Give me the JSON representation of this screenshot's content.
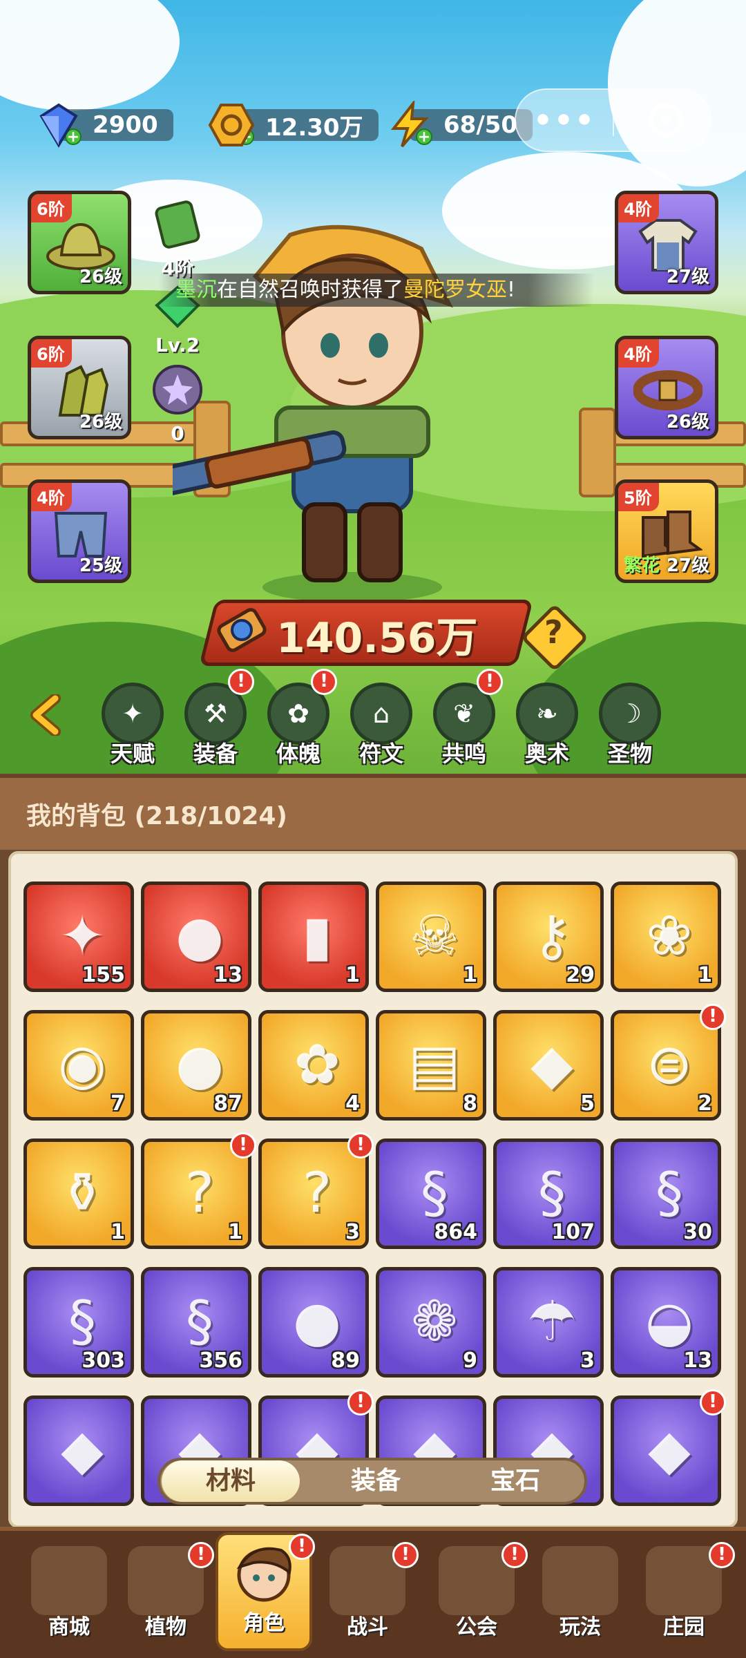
{
  "resources": {
    "gems": "2900",
    "gold": "12.30万",
    "energy": "68/50"
  },
  "equipment": {
    "left": [
      {
        "tier": "6阶",
        "level": "26级"
      },
      {
        "tier": "6阶",
        "level": "26级"
      },
      {
        "tier": "4阶",
        "level": "25级"
      }
    ],
    "right": [
      {
        "tier": "4阶",
        "level": "27级"
      },
      {
        "tier": "4阶",
        "level": "26级"
      },
      {
        "tier": "5阶",
        "level": "27级",
        "tag": "繁花"
      }
    ],
    "mini": [
      {
        "label": "4阶"
      },
      {
        "label": "Lv.2"
      },
      {
        "label": "0"
      }
    ]
  },
  "announcement": {
    "player": "墨沉",
    "middle": "在自然召唤时获得了",
    "reward": "曼陀罗女巫",
    "end": "!"
  },
  "power": "140.56万",
  "features": [
    {
      "label": "天赋",
      "badge": ""
    },
    {
      "label": "装备",
      "badge": "!"
    },
    {
      "label": "体魄",
      "badge": "!"
    },
    {
      "label": "符文",
      "badge": ""
    },
    {
      "label": "共鸣",
      "badge": "!"
    },
    {
      "label": "奥术",
      "badge": ""
    },
    {
      "label": "圣物",
      "badge": ""
    }
  ],
  "bag": {
    "title": "我的背包 (218/1024)",
    "items": [
      {
        "count": "155",
        "rarity": "red",
        "icon": "star-crystal-icon",
        "badge": ""
      },
      {
        "count": "13",
        "rarity": "red",
        "icon": "red-potion-icon",
        "badge": ""
      },
      {
        "count": "1",
        "rarity": "red",
        "icon": "green-vial-icon",
        "badge": ""
      },
      {
        "count": "1",
        "rarity": "gold",
        "icon": "skull-scroll-icon",
        "badge": ""
      },
      {
        "count": "29",
        "rarity": "gold",
        "icon": "golden-key-icon",
        "badge": ""
      },
      {
        "count": "1",
        "rarity": "gold",
        "icon": "golden-seed-icon",
        "badge": ""
      },
      {
        "count": "7",
        "rarity": "gold",
        "icon": "rune-stone-icon",
        "badge": ""
      },
      {
        "count": "87",
        "rarity": "gold",
        "icon": "orange-potion-icon",
        "badge": ""
      },
      {
        "count": "4",
        "rarity": "gold",
        "icon": "flower-pot-icon",
        "badge": ""
      },
      {
        "count": "8",
        "rarity": "gold",
        "icon": "spell-book-icon",
        "badge": ""
      },
      {
        "count": "5",
        "rarity": "gold",
        "icon": "amber-gem-icon",
        "badge": ""
      },
      {
        "count": "2",
        "rarity": "gold",
        "icon": "purple-scroll-icon",
        "badge": "!"
      },
      {
        "count": "1",
        "rarity": "gold",
        "icon": "red-flask-icon",
        "badge": ""
      },
      {
        "count": "1",
        "rarity": "gold",
        "icon": "mystery-armor-icon",
        "badge": "!"
      },
      {
        "count": "3",
        "rarity": "gold",
        "icon": "mystery-potion-icon",
        "badge": "!"
      },
      {
        "count": "864",
        "rarity": "purple",
        "icon": "green-scroll-icon",
        "badge": ""
      },
      {
        "count": "107",
        "rarity": "purple",
        "icon": "pink-scroll-icon",
        "badge": ""
      },
      {
        "count": "30",
        "rarity": "purple",
        "icon": "blue-scroll-icon",
        "badge": ""
      },
      {
        "count": "303",
        "rarity": "purple",
        "icon": "fire-scroll-icon",
        "badge": ""
      },
      {
        "count": "356",
        "rarity": "purple",
        "icon": "lightning-scroll-icon",
        "badge": ""
      },
      {
        "count": "89",
        "rarity": "purple",
        "icon": "purple-potion-icon",
        "badge": ""
      },
      {
        "count": "9",
        "rarity": "purple",
        "icon": "blue-flower-icon",
        "badge": ""
      },
      {
        "count": "3",
        "rarity": "purple",
        "icon": "watering-can-icon",
        "badge": ""
      },
      {
        "count": "13",
        "rarity": "purple",
        "icon": "fruit-bowl-icon",
        "badge": ""
      },
      {
        "count": "",
        "rarity": "purple",
        "icon": "item-icon",
        "badge": ""
      },
      {
        "count": "",
        "rarity": "purple",
        "icon": "item-icon",
        "badge": ""
      },
      {
        "count": "",
        "rarity": "purple",
        "icon": "item-icon",
        "badge": "!"
      },
      {
        "count": "",
        "rarity": "purple",
        "icon": "item-icon",
        "badge": ""
      },
      {
        "count": "",
        "rarity": "purple",
        "icon": "item-icon",
        "badge": ""
      },
      {
        "count": "",
        "rarity": "purple",
        "icon": "item-icon",
        "badge": "!"
      }
    ]
  },
  "tabs": [
    "材料",
    "装备",
    "宝石"
  ],
  "bottom_nav": [
    {
      "label": "商城",
      "badge": ""
    },
    {
      "label": "植物",
      "badge": "!"
    },
    {
      "label": "角色",
      "badge": "!"
    },
    {
      "label": "战斗",
      "badge": "!"
    },
    {
      "label": "公会",
      "badge": "!"
    },
    {
      "label": "玩法",
      "badge": ""
    },
    {
      "label": "庄园",
      "badge": "!"
    }
  ],
  "colors": {
    "red_rarity": "#d8392a",
    "gold_rarity": "#f2a92a",
    "purple_rarity": "#6a4bd0",
    "badge": "#e43a2b"
  }
}
